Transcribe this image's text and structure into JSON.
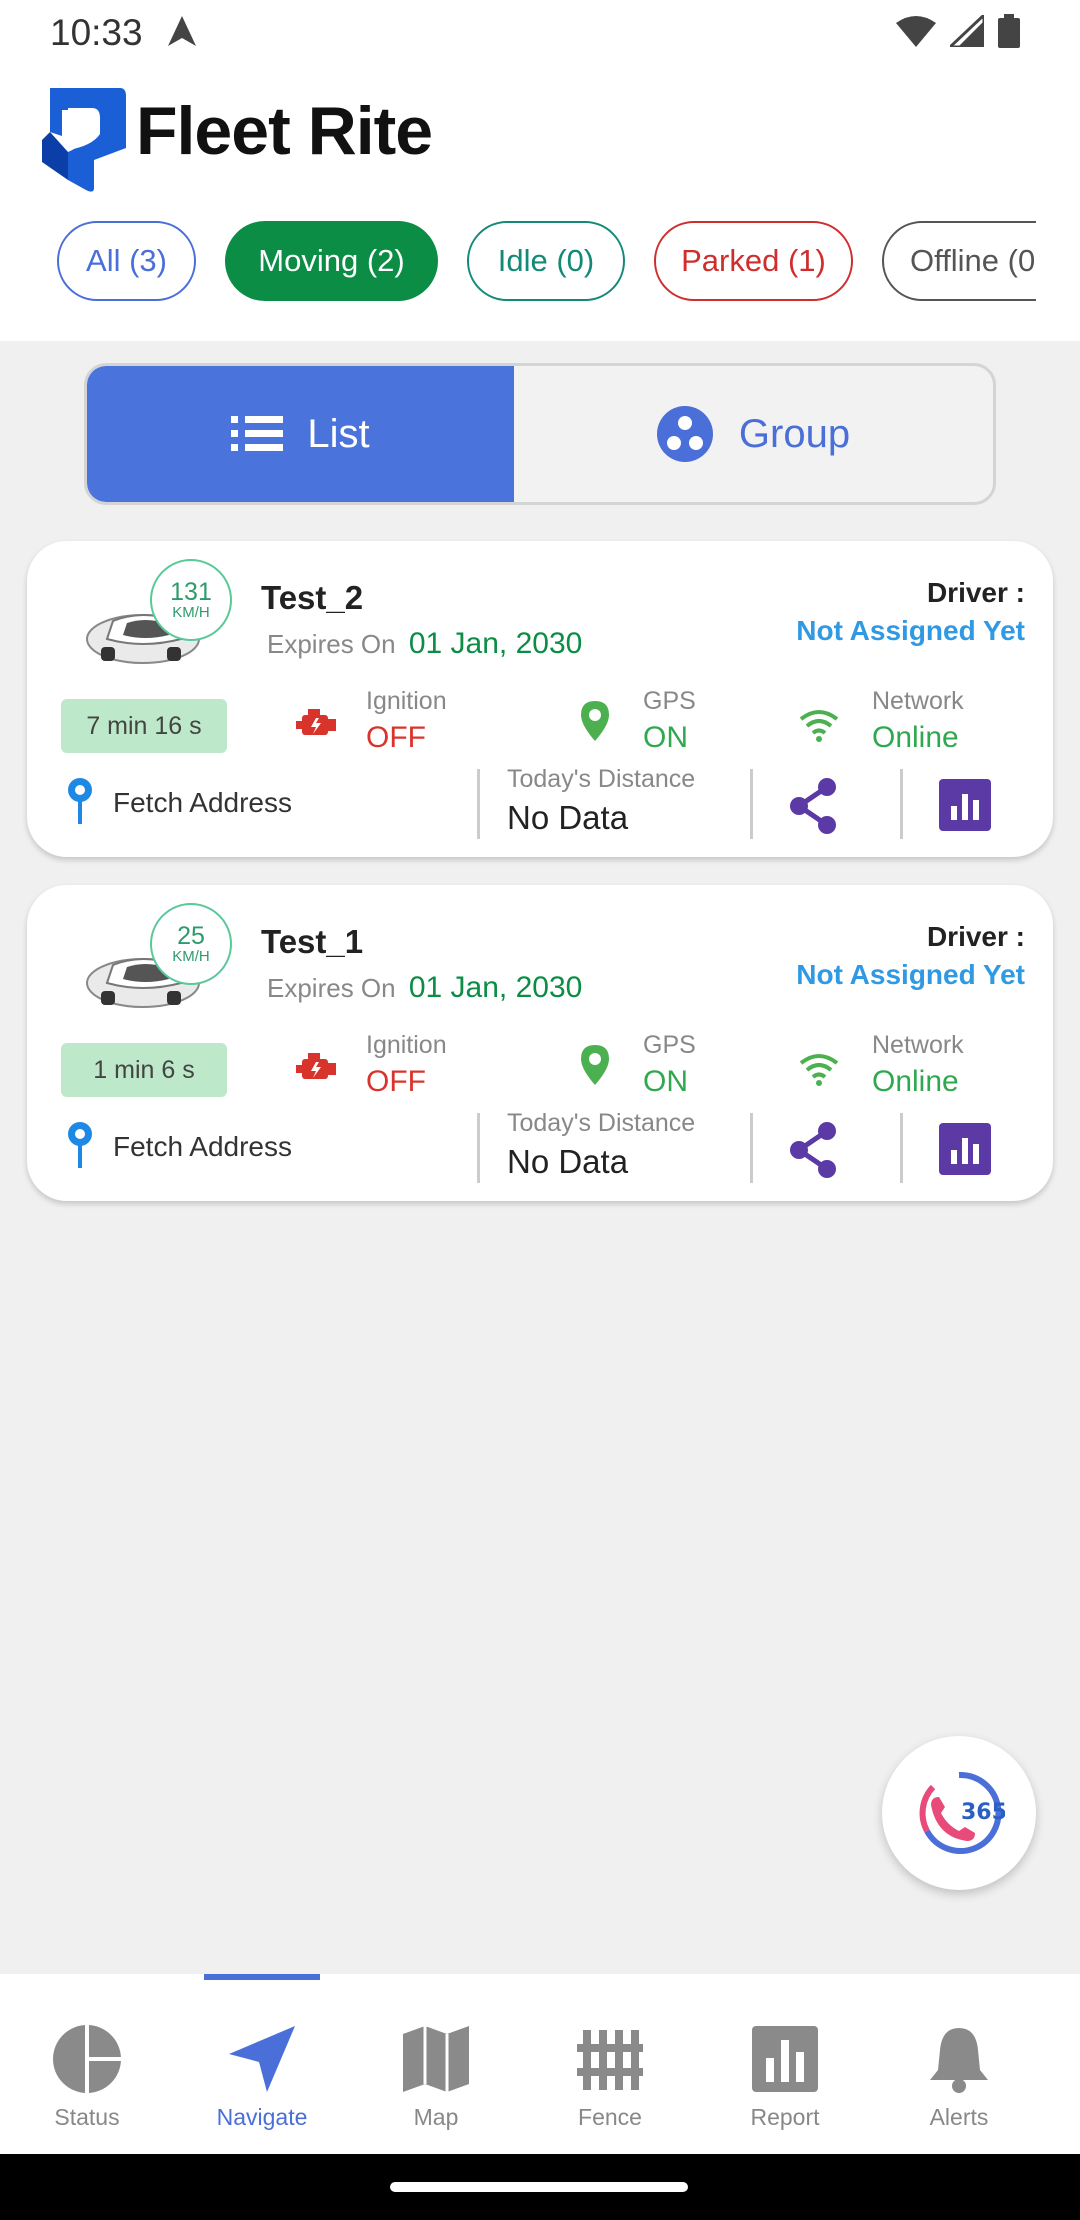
{
  "status_bar": {
    "time": "10:33"
  },
  "header": {
    "app_title": "Fleet Rite"
  },
  "filters": [
    {
      "label": "All (3)"
    },
    {
      "label": "Moving (2)"
    },
    {
      "label": "Idle (0)"
    },
    {
      "label": "Parked (1)"
    },
    {
      "label": "Offline (0"
    }
  ],
  "view_toggle": {
    "list_label": "List",
    "group_label": "Group",
    "selected": "List"
  },
  "vehicles": [
    {
      "name": "Test_2",
      "speed": "131",
      "speed_unit": "KM/H",
      "expires_label": "Expires On",
      "expires_date": "01 Jan, 2030",
      "driver_label": "Driver :",
      "driver_value": "Not Assigned Yet",
      "duration": "7 min 16 s",
      "ignition_label": "Ignition",
      "ignition_value": "OFF",
      "gps_label": "GPS",
      "gps_value": "ON",
      "network_label": "Network",
      "network_value": "Online",
      "address_label": "Fetch Address",
      "distance_label": "Today's Distance",
      "distance_value": "No Data"
    },
    {
      "name": "Test_1",
      "speed": "25",
      "speed_unit": "KM/H",
      "expires_label": "Expires On",
      "expires_date": "01 Jan, 2030",
      "driver_label": "Driver :",
      "driver_value": "Not Assigned Yet",
      "duration": "1 min 6 s",
      "ignition_label": "Ignition",
      "ignition_value": "OFF",
      "gps_label": "GPS",
      "gps_value": "ON",
      "network_label": "Network",
      "network_value": "Online",
      "address_label": "Fetch Address",
      "distance_label": "Today's Distance",
      "distance_value": "No Data"
    }
  ],
  "support_fab": {
    "text": "365"
  },
  "bottom_nav": {
    "active": "Navigate",
    "items": [
      {
        "label": "Status",
        "icon": "pie-chart-icon"
      },
      {
        "label": "Navigate",
        "icon": "navigation-arrow-icon"
      },
      {
        "label": "Map",
        "icon": "map-icon"
      },
      {
        "label": "Fence",
        "icon": "fence-icon"
      },
      {
        "label": "Report",
        "icon": "bar-chart-icon"
      },
      {
        "label": "Alerts",
        "icon": "bell-icon"
      }
    ]
  },
  "colors": {
    "primary": "#4a74dc",
    "moving": "#0b8d45",
    "idle": "#138a78",
    "parked": "#cf2e2e",
    "offline": "#555555",
    "off": "#d9342b",
    "on": "#2fa84f",
    "driver": "#2f9ae3",
    "report": "#5c3aa6"
  }
}
